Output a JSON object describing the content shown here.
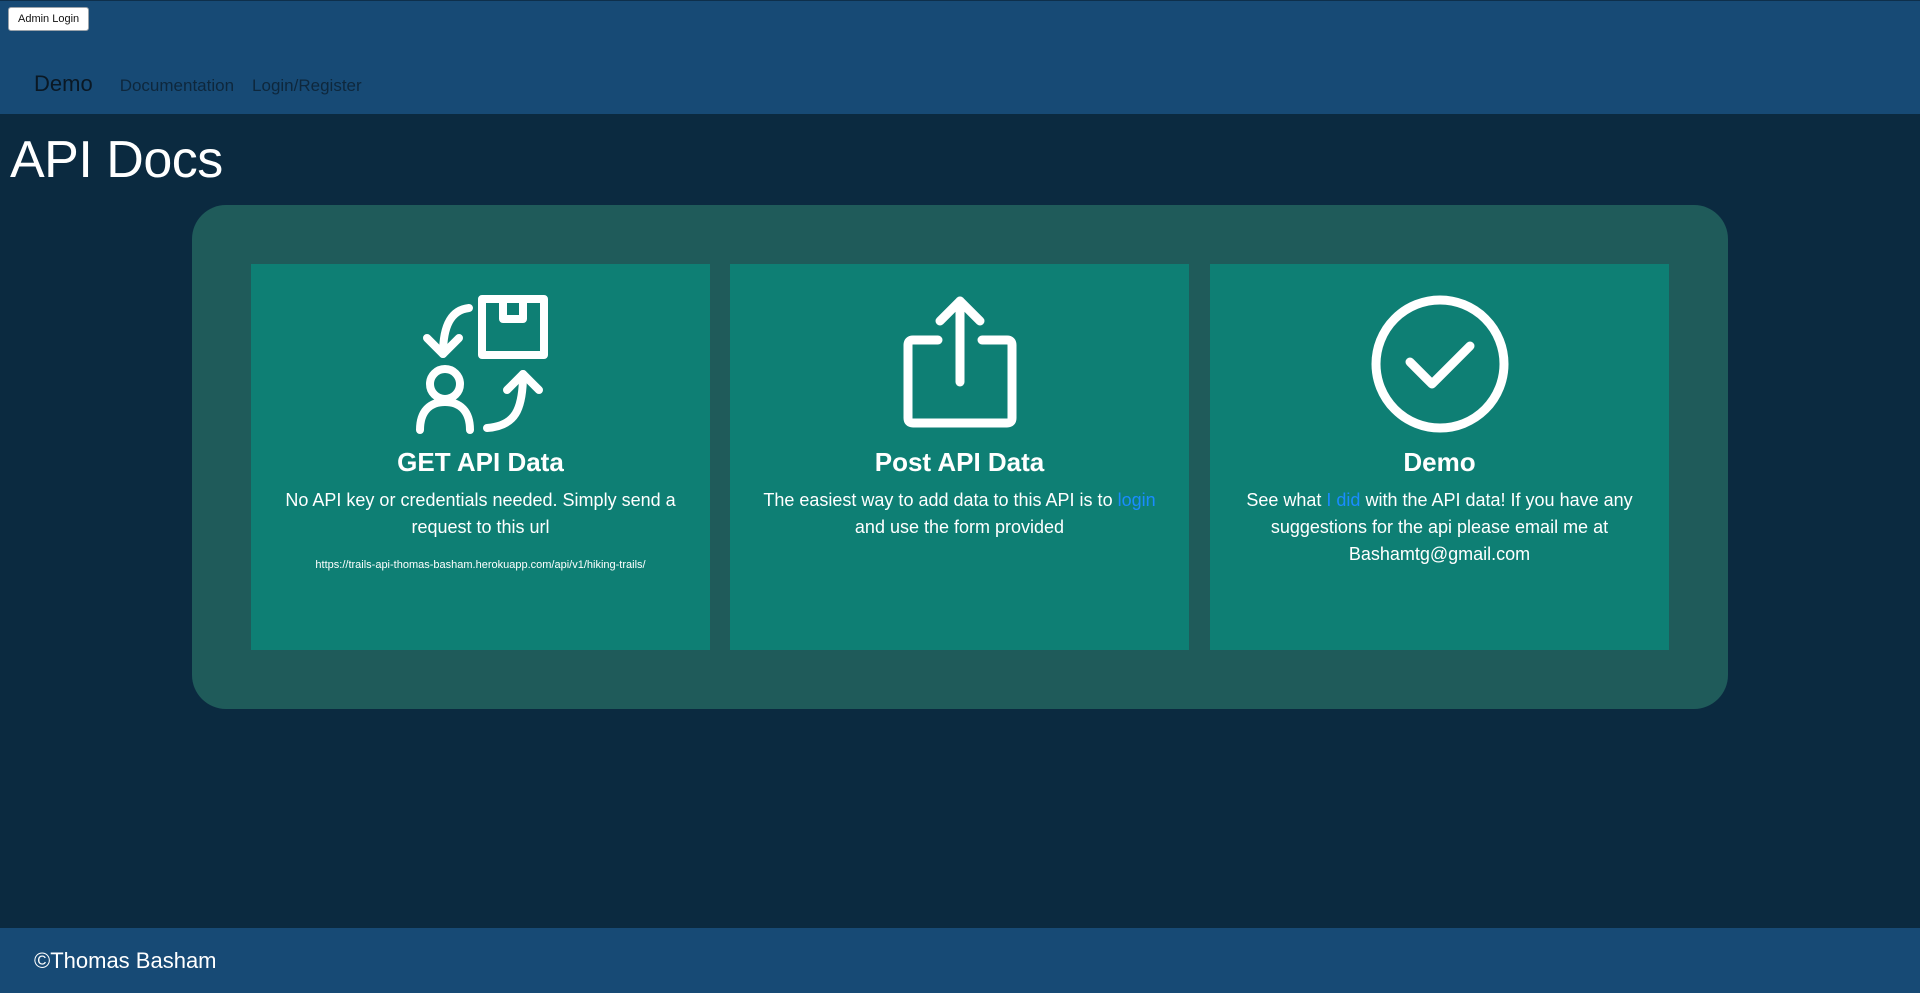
{
  "header": {
    "admin_button": "Admin Login",
    "brand": "Demo",
    "nav": [
      {
        "label": "Documentation"
      },
      {
        "label": "Login/Register"
      }
    ]
  },
  "page": {
    "title": "API Docs"
  },
  "cards": [
    {
      "icon": "data-exchange-icon",
      "title": "GET API Data",
      "text": "No API key or credentials needed. Simply send a request to this url",
      "url": "https://trails-api-thomas-basham.herokuapp.com/api/v1/hiking-trails/"
    },
    {
      "icon": "share-upload-icon",
      "title": "Post API Data",
      "text_before": "The easiest way to add data to this API is to ",
      "link": "login",
      "text_after": " and use the form provided"
    },
    {
      "icon": "check-circle-icon",
      "title": "Demo",
      "text_before": "See what ",
      "link": "I did",
      "text_after": " with the API data! If you have any suggestions for the api please email me at Bashamtg@gmail.com"
    }
  ],
  "footer": {
    "copyright": "©Thomas Basham"
  },
  "colors": {
    "background": "#0b2a40",
    "header": "#174a75",
    "panel": "#1f5b5a",
    "card": "#0e7f74",
    "link": "#1a8cff"
  }
}
